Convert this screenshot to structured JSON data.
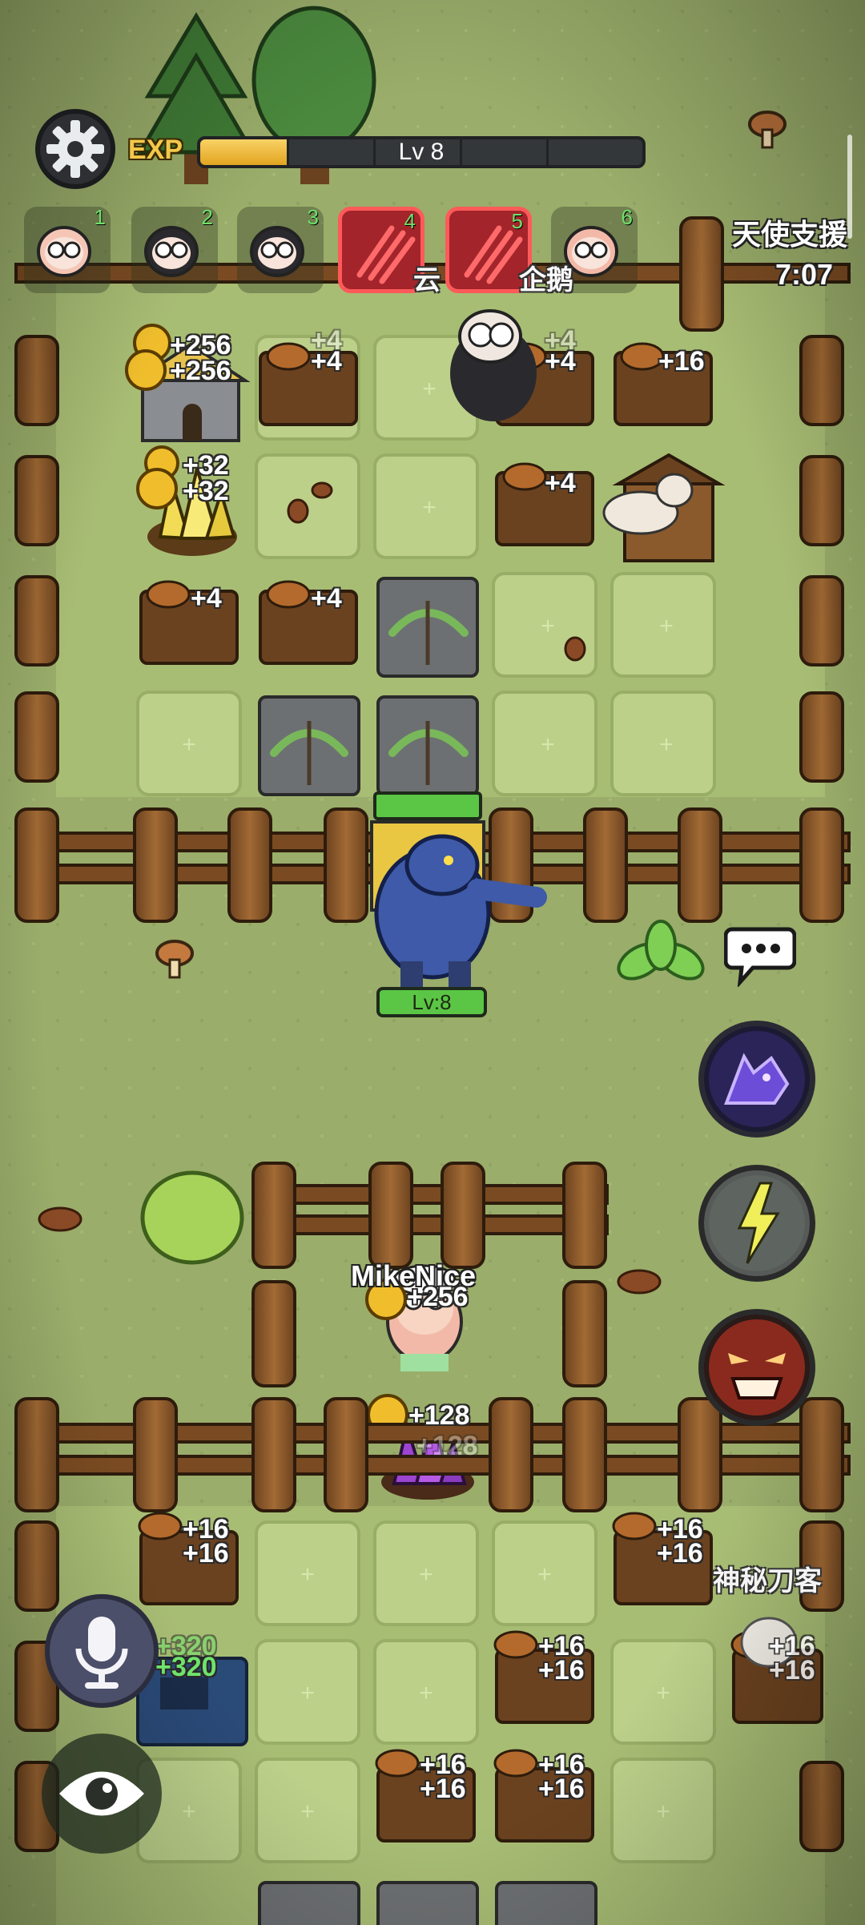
{
  "hud": {
    "settings_icon": "gear-icon",
    "exp_label": "EXP",
    "level_label": "Lv 8",
    "exp_progress_fraction": 0.2,
    "team_slots": [
      {
        "number": "1",
        "kind": "sheep-chef",
        "highlighted": false
      },
      {
        "number": "2",
        "kind": "sheep-ninja",
        "highlighted": false
      },
      {
        "number": "3",
        "kind": "sheep-spiky",
        "highlighted": false
      },
      {
        "number": "4",
        "kind": "claw-skill",
        "highlighted": true
      },
      {
        "number": "5",
        "kind": "claw-skill",
        "highlighted": true
      },
      {
        "number": "6",
        "kind": "sheep-plain",
        "highlighted": false
      }
    ],
    "angel_support": {
      "title": "天使支援",
      "timer": "7:07"
    }
  },
  "field": {
    "enemy_name_partial": "云",
    "enemy_name_partial_2": "企鹅",
    "top_yard": {
      "popups": [
        {
          "text": "+256",
          "kind": "gold"
        },
        {
          "text": "+256",
          "kind": "gold"
        },
        {
          "text": "+4",
          "kind": "wood"
        },
        {
          "text": "+4",
          "kind": "wood"
        },
        {
          "text": "+4",
          "kind": "wood"
        },
        {
          "text": "+16",
          "kind": "wood"
        },
        {
          "text": "+32",
          "kind": "gold"
        },
        {
          "text": "+32",
          "kind": "gold"
        },
        {
          "text": "+4",
          "kind": "wood"
        },
        {
          "text": "+4",
          "kind": "wood"
        },
        {
          "text": "+4",
          "kind": "wood"
        },
        {
          "text": "+4",
          "kind": "wood"
        }
      ]
    },
    "boss": {
      "level_label": "Lv:8",
      "kind": "blue-werewolf"
    },
    "player": {
      "name": "MikeNice",
      "gold_gain": "+256",
      "crystal_gain": "+128",
      "crystal_ghost": "+128"
    },
    "bottom_yard": {
      "popups": [
        {
          "text": "+16",
          "kind": "wood"
        },
        {
          "text": "+16",
          "kind": "wood"
        },
        {
          "text": "+320",
          "kind": "green"
        },
        {
          "text": "+320",
          "kind": "green"
        },
        {
          "text": "+16",
          "kind": "wood"
        },
        {
          "text": "+16",
          "kind": "wood"
        },
        {
          "text": "+16",
          "kind": "wood"
        },
        {
          "text": "+16",
          "kind": "wood"
        },
        {
          "text": "+16",
          "kind": "wood"
        },
        {
          "text": "+16",
          "kind": "wood"
        },
        {
          "text": "+16",
          "kind": "wood"
        },
        {
          "text": "+16",
          "kind": "wood"
        }
      ],
      "neighbor_name": "神秘刀客",
      "neighbor_popups": [
        "+16",
        "+16"
      ]
    }
  },
  "controls": {
    "chat_icon": "chat-bubble-icon",
    "skills": [
      {
        "name": "wolf-howl-skill",
        "icon": "wolf-head-icon"
      },
      {
        "name": "lightning-skill",
        "icon": "lightning-figure-icon"
      },
      {
        "name": "rage-skill",
        "icon": "angry-face-icon"
      }
    ],
    "mic_icon": "microphone-icon",
    "eye_icon": "eye-icon"
  },
  "colors": {
    "grass": "#9aad6a",
    "tile": "#b7cb86",
    "fence": "#8a5a2c",
    "exp_fill": "#f2b530",
    "highlight_red": "#a3242a",
    "level_green": "#5bc645"
  }
}
